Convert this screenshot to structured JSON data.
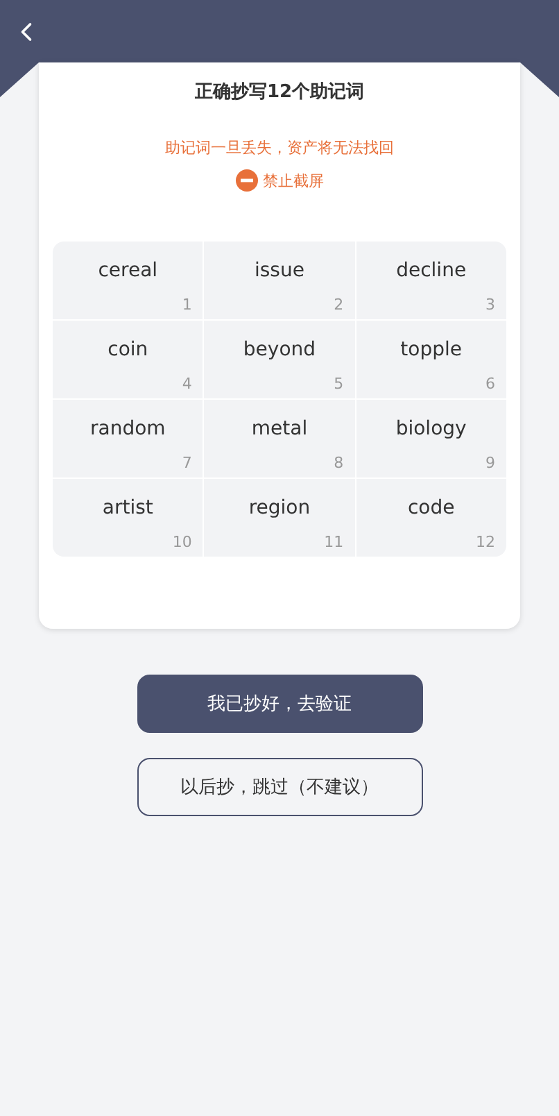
{
  "card": {
    "title": "正确抄写12个助记词",
    "warning": "助记词一旦丢失，资产将无法找回",
    "notice": "禁止截屏",
    "words": [
      {
        "word": "cereal",
        "index": "1"
      },
      {
        "word": "issue",
        "index": "2"
      },
      {
        "word": "decline",
        "index": "3"
      },
      {
        "word": "coin",
        "index": "4"
      },
      {
        "word": "beyond",
        "index": "5"
      },
      {
        "word": "topple",
        "index": "6"
      },
      {
        "word": "random",
        "index": "7"
      },
      {
        "word": "metal",
        "index": "8"
      },
      {
        "word": "biology",
        "index": "9"
      },
      {
        "word": "artist",
        "index": "10"
      },
      {
        "word": "region",
        "index": "11"
      },
      {
        "word": "code",
        "index": "12"
      }
    ]
  },
  "buttons": [
    {
      "label": "我已抄好，去验证",
      "kind": "primary"
    },
    {
      "label": "以后抄，跳过（不建议）",
      "kind": "outline"
    }
  ]
}
